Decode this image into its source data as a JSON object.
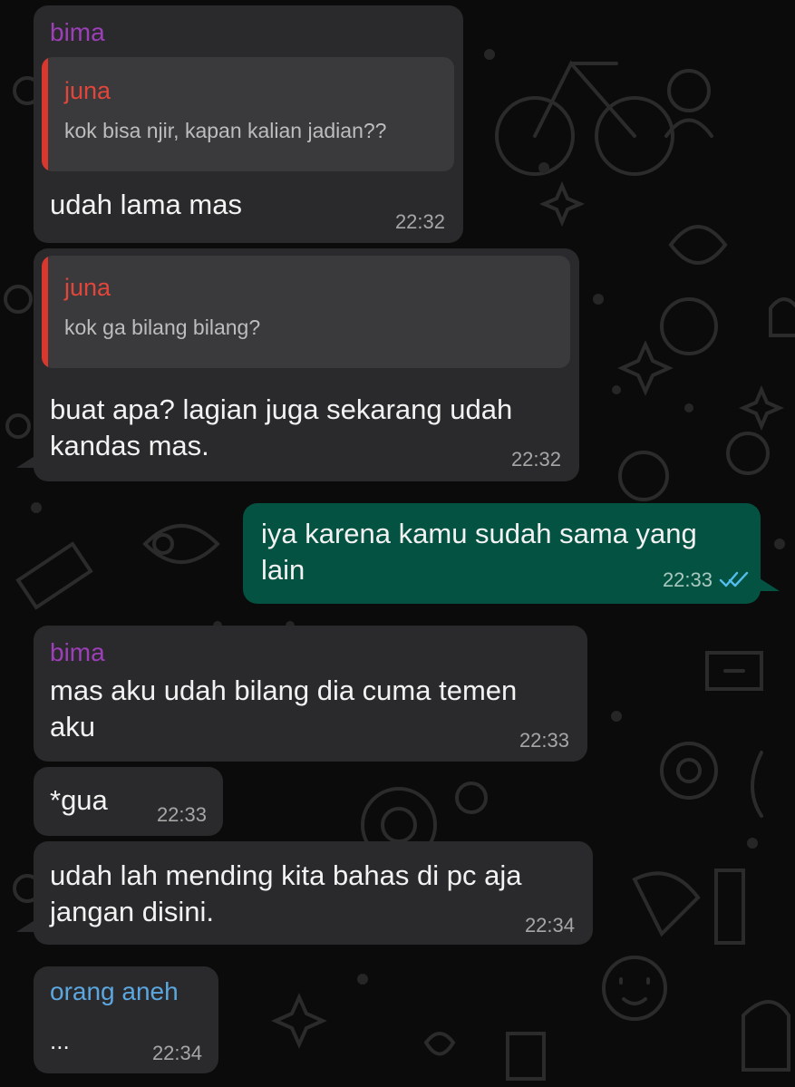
{
  "colors": {
    "background": "#0b0b0b",
    "incoming_bubble": "#2a2a2c",
    "outgoing_bubble": "#045241",
    "sender_bima": "#9c3fb8",
    "sender_orang_aneh": "#5ba7e0",
    "quote_accent": "#d9382f",
    "read_ticks": "#53bdeb"
  },
  "messages": [
    {
      "sender": "bima",
      "quote": {
        "name": "juna",
        "text": "kok bisa njir, kapan kalian jadian??"
      },
      "text": "udah lama mas",
      "time": "22:32"
    },
    {
      "quote": {
        "name": "juna",
        "text": "kok ga bilang bilang?"
      },
      "text": "buat apa? lagian juga sekarang udah\nkandas mas.",
      "time": "22:32"
    },
    {
      "direction": "outgoing",
      "text": "iya karena kamu sudah sama yang\nlain",
      "time": "22:33",
      "status_icon": "double-check-read-icon"
    },
    {
      "sender": "bima",
      "text": "mas aku udah bilang dia cuma temen\naku",
      "time": "22:33"
    },
    {
      "text": "*gua",
      "time": "22:33"
    },
    {
      "text": "udah lah mending kita bahas di pc aja\njangan disini.",
      "time": "22:34"
    },
    {
      "sender": "orang aneh",
      "text": "...",
      "time": "22:34"
    }
  ]
}
